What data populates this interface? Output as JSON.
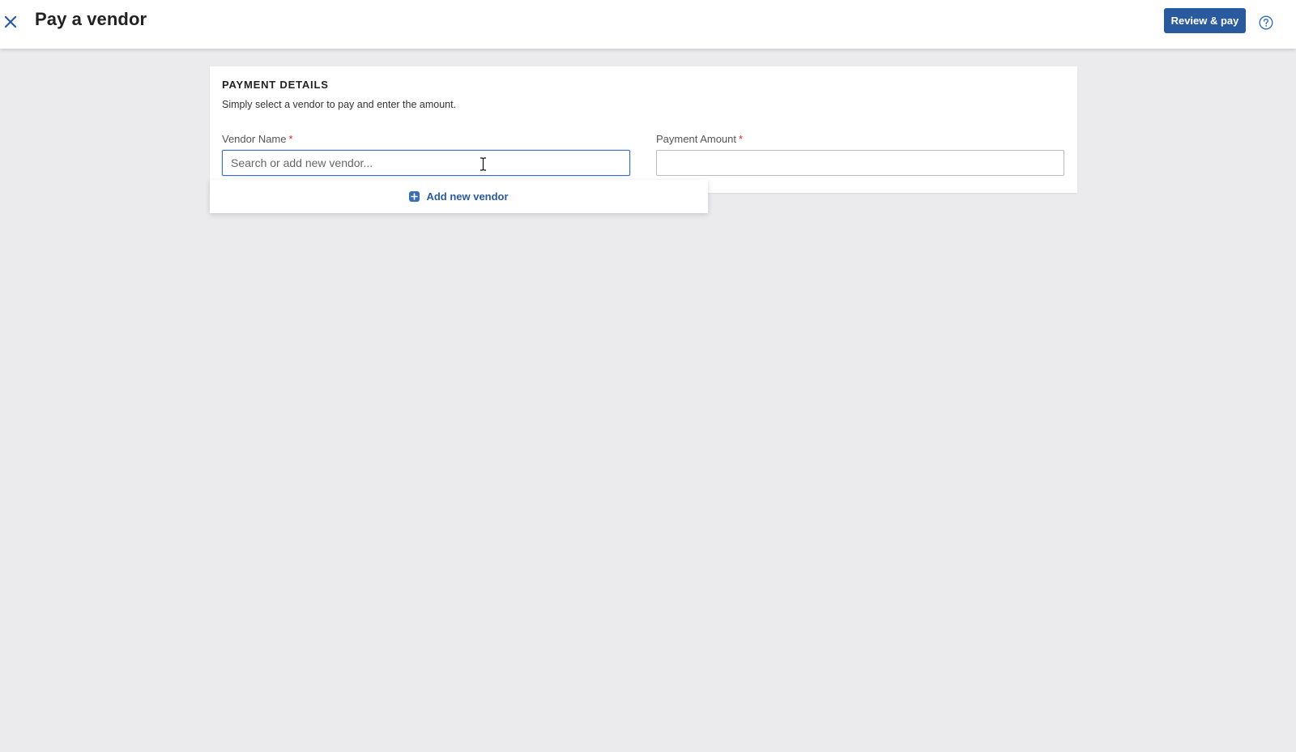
{
  "header": {
    "title": "Pay a vendor",
    "primary_action": "Review & pay",
    "close_icon": "close-icon",
    "help_icon": "help-icon"
  },
  "payment_details": {
    "section_title": "PAYMENT DETAILS",
    "description": "Simply select a vendor to pay and enter the amount.",
    "vendor_field": {
      "label": "Vendor Name",
      "required_marker": "*",
      "placeholder": "Search or add new vendor...",
      "value": ""
    },
    "amount_field": {
      "label": "Payment Amount",
      "required_marker": "*",
      "placeholder": "",
      "value": ""
    }
  },
  "vendor_dropdown": {
    "add_new_label": "Add new vendor",
    "add_icon": "plus-square-icon"
  },
  "colors": {
    "accent": "#2a5a9e",
    "focus_border": "#3a6eb5",
    "required": "#d0302a",
    "page_background": "#ebeaed"
  }
}
